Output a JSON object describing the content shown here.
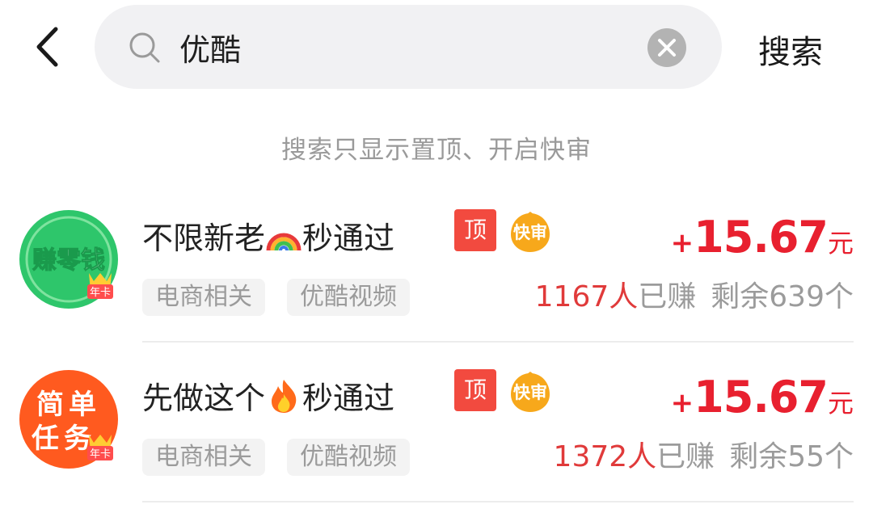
{
  "header": {
    "search_value": "优酷",
    "search_button": "搜索"
  },
  "notice": "搜索只显示置顶、开启快审",
  "tasks": [
    {
      "avatar_text": "赚零钱",
      "avatar_badge": "年卡",
      "avatar_color": "#2ec66b",
      "title_before": "不限新老",
      "title_emoji": "rainbow-emoji",
      "title_after": "秒通过",
      "top_badge": "顶",
      "fast_badge": "快审",
      "reward_plus": "+",
      "reward_amount": "15.67",
      "reward_unit": "元",
      "tags": [
        "电商相关",
        "优酷视频"
      ],
      "earned_count": "1167人",
      "earned_suffix": "已赚",
      "remaining": "剩余639个"
    },
    {
      "avatar_text_line1": "简单",
      "avatar_text_line2": "任务",
      "avatar_badge": "年卡",
      "avatar_color": "#ff5a1f",
      "title_before": "先做这个",
      "title_emoji": "fire-emoji",
      "title_after": "秒通过",
      "top_badge": "顶",
      "fast_badge": "快审",
      "reward_plus": "+",
      "reward_amount": "15.67",
      "reward_unit": "元",
      "tags": [
        "电商相关",
        "优酷视频"
      ],
      "earned_count": "1372人",
      "earned_suffix": "已赚",
      "remaining": "剩余55个"
    }
  ]
}
